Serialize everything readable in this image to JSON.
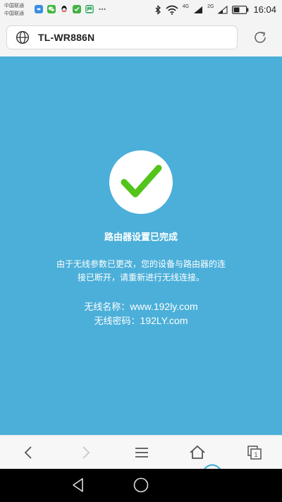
{
  "status_bar": {
    "carrier_1": "中国联通",
    "carrier_2": "中国联通",
    "net_1": "4G",
    "net_2": "2G",
    "time": "16:04",
    "icons": [
      "alipay-icon",
      "wechat-icon",
      "qq-icon",
      "wechat-green-icon",
      "image-icon",
      "more-icon",
      "bluetooth-icon",
      "wifi-icon",
      "signal-icon",
      "battery-icon"
    ]
  },
  "address_bar": {
    "url": "TL-WR886N",
    "icon": "globe-icon",
    "reload_icon": "reload-icon"
  },
  "page": {
    "background_color": "#4bafd9",
    "check_color": "#52c41a",
    "title": "路由器设置已完成",
    "message_line_1": "由于无线参数已更改，您的设备与路由器的连",
    "message_line_2": "接已断开，请重新进行无线连接。",
    "ssid_label": "无线名称：",
    "ssid_value": "www.192ly.com",
    "password_label": "无线密码：",
    "password_value": "192LY.com"
  },
  "toolbar": {
    "buttons": [
      "back-icon",
      "forward-icon",
      "menu-icon",
      "home-icon",
      "tabs-icon"
    ],
    "tab_count": "1"
  },
  "navbar": {
    "buttons": [
      "nav-back-icon",
      "nav-home-icon"
    ]
  }
}
